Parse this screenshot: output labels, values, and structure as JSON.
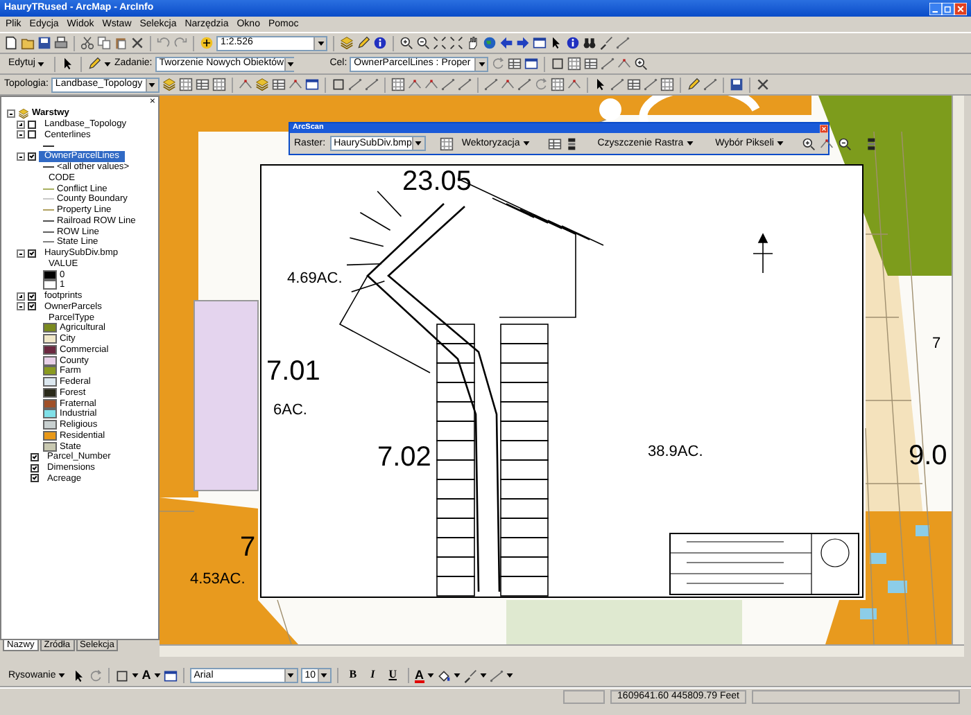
{
  "window": {
    "title": "HauryTRused - ArcMap - ArcInfo"
  },
  "menu": [
    "Plik",
    "Edycja",
    "Widok",
    "Wstaw",
    "Selekcja",
    "Narzędzia",
    "Okno",
    "Pomoc"
  ],
  "standard_toolbar": {
    "scale": "1:2.526"
  },
  "editor_toolbar": {
    "menu": "Edytuj",
    "task_label": "Zadanie:",
    "task": "Tworzenie Nowych Obiektów",
    "target_label": "Cel:",
    "target": "OwnerParcelLines : Proper"
  },
  "topology_toolbar": {
    "label": "Topologia:",
    "topology": "Landbase_Topology"
  },
  "toc": {
    "close": "×",
    "root": {
      "label": "Warstwy",
      "expanded": true,
      "children": [
        {
          "kind": "layer",
          "label": "Landbase_Topology",
          "checked": false,
          "expanded": false,
          "selected": false
        },
        {
          "kind": "layer",
          "label": "Centerlines",
          "checked": false,
          "expanded": true,
          "selected": false,
          "legend": [
            {
              "kind": "line",
              "color": "#303030"
            }
          ]
        },
        {
          "kind": "layer",
          "label": "OwnerParcelLines",
          "checked": true,
          "expanded": true,
          "selected": true,
          "legend": [
            {
              "kind": "line",
              "label": "<all other values>",
              "color": "#404040"
            },
            {
              "kind": "heading",
              "label": "CODE"
            },
            {
              "kind": "line",
              "label": "Conflict Line",
              "color": "#a8b060"
            },
            {
              "kind": "line",
              "label": "County Boundary",
              "color": "#c8c8c8"
            },
            {
              "kind": "line",
              "label": "Property Line",
              "color": "#b0a060"
            },
            {
              "kind": "line",
              "label": "Railroad ROW Line",
              "color": "#505050"
            },
            {
              "kind": "line",
              "label": "ROW Line",
              "color": "#606060"
            },
            {
              "kind": "line",
              "label": "State Line",
              "color": "#808080"
            }
          ]
        },
        {
          "kind": "layer",
          "label": "HaurySubDiv.bmp",
          "checked": true,
          "expanded": true,
          "selected": false,
          "legend": [
            {
              "kind": "heading",
              "label": "VALUE"
            },
            {
              "kind": "swatch",
              "label": "0",
              "color": "#000000"
            },
            {
              "kind": "swatch",
              "label": "1",
              "color": "#ffffff"
            }
          ]
        },
        {
          "kind": "layer",
          "label": "footprints",
          "checked": true,
          "expanded": false,
          "selected": false
        },
        {
          "kind": "layer",
          "label": "OwnerParcels",
          "checked": true,
          "expanded": true,
          "selected": false,
          "legend": [
            {
              "kind": "heading",
              "label": "ParcelType"
            },
            {
              "kind": "swatch",
              "label": "Agricultural",
              "color": "#7a8a1e"
            },
            {
              "kind": "swatch",
              "label": "City",
              "color": "#f0e8c8"
            },
            {
              "kind": "swatch",
              "label": "Commercial",
              "color": "#6b2840"
            },
            {
              "kind": "swatch",
              "label": "County",
              "color": "#e8d0e8"
            },
            {
              "kind": "swatch",
              "label": "Farm",
              "color": "#8a9a20"
            },
            {
              "kind": "swatch",
              "label": "Federal",
              "color": "#dce8f0"
            },
            {
              "kind": "swatch",
              "label": "Forest",
              "color": "#2a2a1a"
            },
            {
              "kind": "swatch",
              "label": "Fraternal",
              "color": "#a05028"
            },
            {
              "kind": "swatch",
              "label": "Industrial",
              "color": "#80e0e8"
            },
            {
              "kind": "swatch",
              "label": "Religious",
              "color": "#c8d0d0"
            },
            {
              "kind": "swatch",
              "label": "Residential",
              "color": "#e89818"
            },
            {
              "kind": "swatch",
              "label": "State",
              "color": "#c8c8b0"
            }
          ]
        },
        {
          "kind": "annotation",
          "label": "Parcel_Number",
          "checked": true,
          "selected": false
        },
        {
          "kind": "annotation",
          "label": "Dimensions",
          "checked": true,
          "selected": false
        },
        {
          "kind": "annotation",
          "label": "Acreage",
          "checked": true,
          "selected": false
        }
      ]
    },
    "tabs": [
      {
        "label": "Nazwy",
        "selected": true
      },
      {
        "label": "Źródła",
        "selected": false
      },
      {
        "label": "Selekcja",
        "selected": false
      }
    ]
  },
  "map": {
    "labels": [
      {
        "text": "23.05",
        "kind": "parcel"
      },
      {
        "text": "4.69AC.",
        "kind": "acreage"
      },
      {
        "text": "7.01",
        "kind": "parcel"
      },
      {
        "text": "6AC.",
        "kind": "acreage"
      },
      {
        "text": "7.02",
        "kind": "parcel"
      },
      {
        "text": "38.9AC.",
        "kind": "acreage"
      },
      {
        "text": "7",
        "kind": "parcel"
      },
      {
        "text": "4.53AC.",
        "kind": "acreage"
      },
      {
        "text": "9.0",
        "kind": "parcel"
      },
      {
        "text": "7",
        "kind": "acreage"
      }
    ]
  },
  "arcscan": {
    "title": "ArcScan",
    "raster_label": "Raster:",
    "raster": "HaurySubDiv.bmp",
    "menus": [
      "Wektoryzacja",
      "Czyszczenie Rastra",
      "Wybór Pikseli"
    ]
  },
  "drawing_toolbar": {
    "menu": "Rysowanie",
    "text_tool": "A",
    "font": "Arial",
    "size": "10",
    "styles": [
      "B",
      "I",
      "U"
    ],
    "font_color": "A"
  },
  "status_bar": {
    "coordinates": "1609641.60  445809.79 Feet"
  }
}
